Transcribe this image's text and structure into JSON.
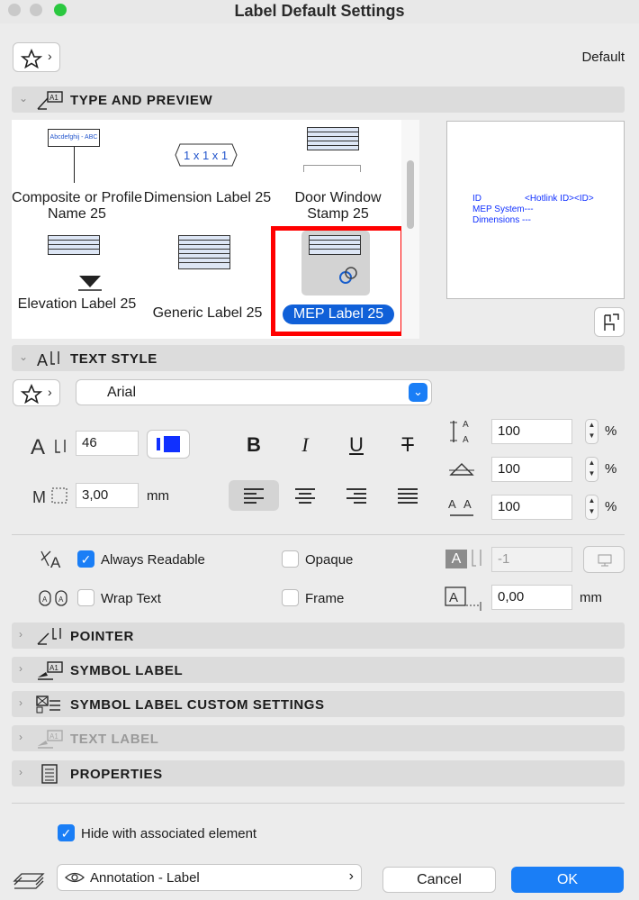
{
  "window": {
    "title": "Label Default Settings"
  },
  "header": {
    "default_label": "Default"
  },
  "sections": {
    "type_preview": "TYPE AND PREVIEW",
    "text_style": "TEXT STYLE",
    "pointer": "POINTER",
    "symbol_label": "SYMBOL LABEL",
    "symbol_custom": "SYMBOL LABEL CUSTOM SETTINGS",
    "text_label": "TEXT LABEL",
    "properties": "PROPERTIES"
  },
  "gallery": {
    "items": [
      {
        "label": "Composite or Profile Name 25",
        "thumb_text": "Abcdefghij - ABC"
      },
      {
        "label": "Dimension Label 25",
        "thumb_text": "1 x 1 x 1"
      },
      {
        "label": "Door Window Stamp 25"
      },
      {
        "label": "Elevation Label 25"
      },
      {
        "label": "Generic Label 25"
      },
      {
        "label": "MEP Label 25",
        "selected": true
      }
    ]
  },
  "preview": {
    "line1_a": "ID",
    "line1_b": "<Hotlink ID><ID>",
    "line2": "MEP System---",
    "line3": "Dimensions ---"
  },
  "text_style": {
    "font": "Arial",
    "size": "46",
    "spacing": "3,00",
    "spacing_unit": "mm",
    "height_pct": "100",
    "width_pct": "100",
    "letter_pct": "100",
    "pct_unit": "%",
    "bold": "B",
    "italic": "I",
    "underline": "U",
    "strike": "T"
  },
  "options": {
    "always_readable": "Always Readable",
    "opaque": "Opaque",
    "wrap_text": "Wrap Text",
    "frame": "Frame",
    "pen_value": "-1",
    "frame_offset": "0,00",
    "frame_unit": "mm"
  },
  "footer": {
    "hide_with_element": "Hide with associated element",
    "layer": "Annotation - Label",
    "cancel": "Cancel",
    "ok": "OK"
  },
  "colors": {
    "accent": "#1a7ef6",
    "selection_border": "#ff0000",
    "preview_text": "#1030ff"
  }
}
